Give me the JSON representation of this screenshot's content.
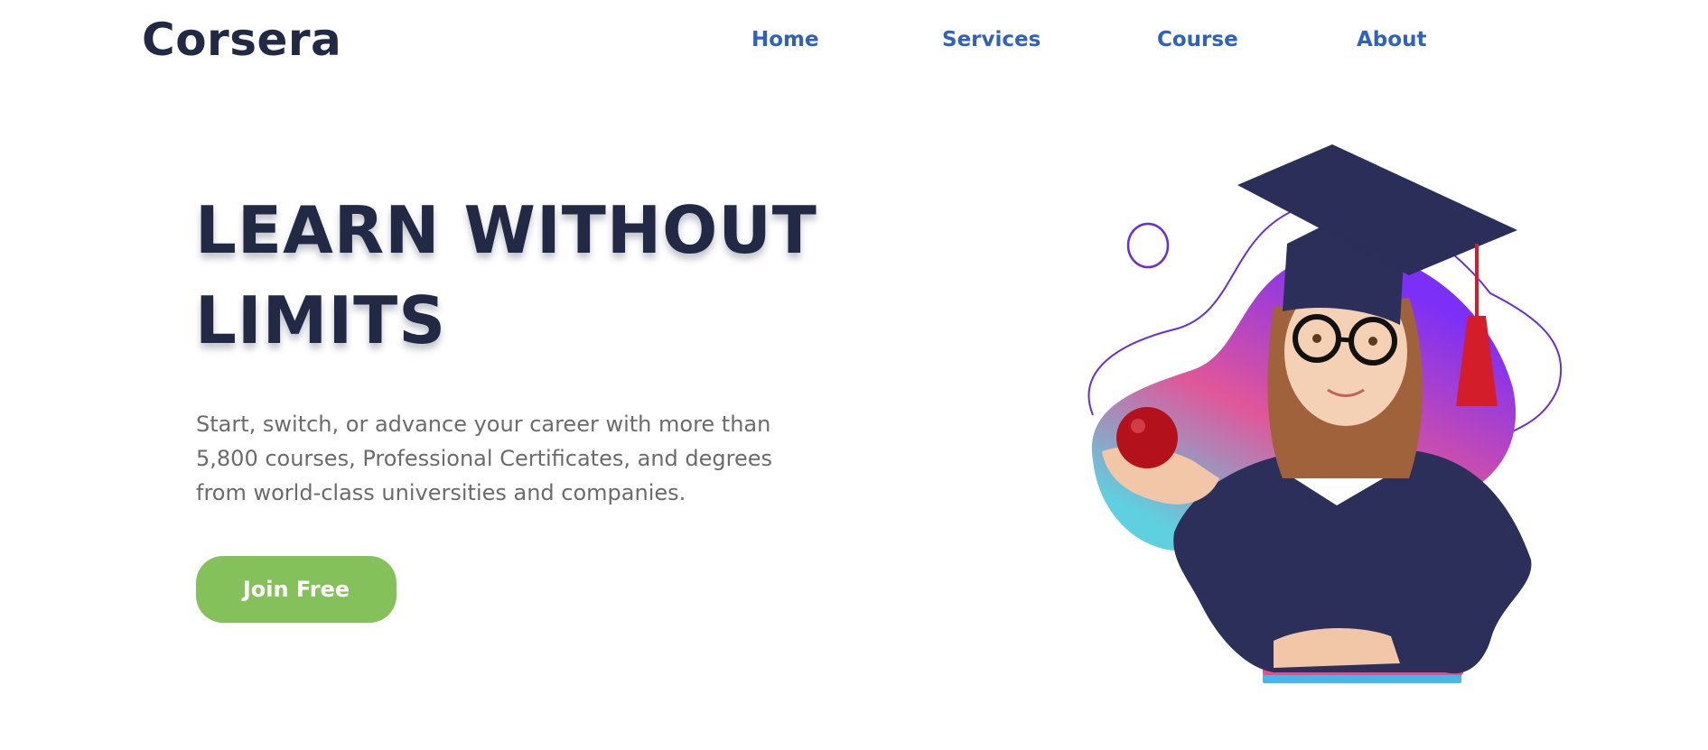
{
  "header": {
    "logo": "Corsera",
    "nav": [
      {
        "label": "Home"
      },
      {
        "label": "Services"
      },
      {
        "label": "Course"
      },
      {
        "label": "About"
      }
    ]
  },
  "hero": {
    "title_line1": "LEARN WITHOUT",
    "title_line2": "LIMITS",
    "description": "Start, switch, or advance your career with more than 5,800 courses, Professional Certificates, and degrees from world-class universities and companies.",
    "cta_label": "Join Free"
  },
  "colors": {
    "brand_dark": "#212945",
    "nav_link": "#2f62bd",
    "cta_green": "#84c15b",
    "body_text": "#6b6b6b",
    "blob_gradient": [
      "#7b2ff7",
      "#e0569a",
      "#5fd0e0"
    ]
  },
  "illustration": {
    "subject": "girl-graduate-with-apple-icon"
  }
}
